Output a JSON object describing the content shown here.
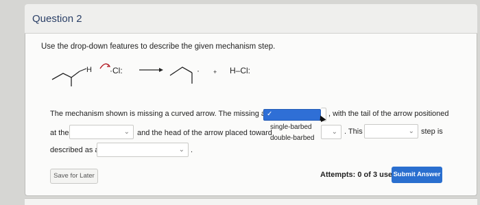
{
  "question": {
    "title": "Question 2",
    "prompt": "Use the drop-down features to describe the given mechanism step."
  },
  "mechanism": {
    "h_label": "H",
    "cl_reactant": "·Cl:",
    "plus": "+",
    "product_hcl": "H–Cl:",
    "dot": "·"
  },
  "sentence": {
    "part1": "The mechanism shown is missing a curved arrow. The missing arrow is",
    "part2": ", with the tail of the arrow positioned",
    "part3": "at the",
    "part4": "and the head of the arrow placed toward",
    "part5": ". This",
    "part6": "step is",
    "part7": "described as a",
    "part8": "."
  },
  "dropdown_open": {
    "selected": "✓",
    "options": [
      "single-barbed",
      "double-barbed"
    ]
  },
  "buttons": {
    "save": "Save for Later",
    "submit": "Submit Answer"
  },
  "attempts": "Attempts: 0 of 3 used",
  "icons": {
    "chevron": "⌄",
    "check": "✓"
  }
}
